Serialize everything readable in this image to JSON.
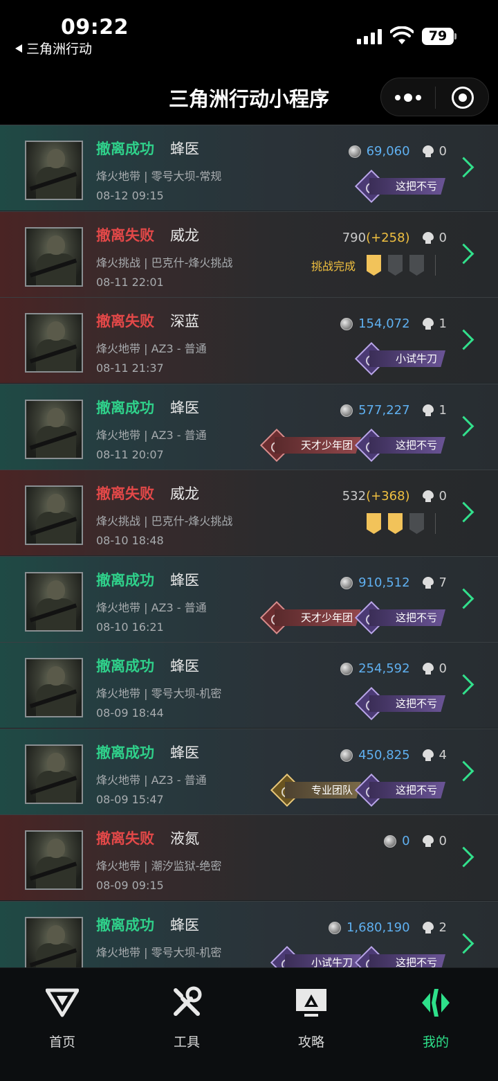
{
  "status_bar": {
    "time": "09:22",
    "back_app": "三角洲行动",
    "battery": "79"
  },
  "nav": {
    "title": "三角洲行动小程序"
  },
  "colors": {
    "success": "#2fd08a",
    "fail": "#e24848",
    "value_blue": "#5fb0f0",
    "bonus_yellow": "#f0c040",
    "accent_green": "#32e08c"
  },
  "records": [
    {
      "status": "撤离成功",
      "result": "success",
      "operator": "蜂医",
      "mode": "烽火地带 | 零号大坝-常规",
      "date": "08-12 09:15",
      "value": "69,060",
      "kills": "0",
      "badges": [
        {
          "label": "这把不亏",
          "style": "purple"
        }
      ]
    },
    {
      "status": "撤离失败",
      "result": "fail",
      "operator": "威龙",
      "mode": "烽火挑战 | 巴克什-烽火挑战",
      "date": "08-11 22:01",
      "value": "790",
      "bonus": "(+258)",
      "kills": "0",
      "challenge": {
        "label": "挑战完成",
        "filled": 1,
        "total": 3
      }
    },
    {
      "status": "撤离失败",
      "result": "fail",
      "operator": "深蓝",
      "mode": "烽火地带 | AZ3 - 普通",
      "date": "08-11 21:37",
      "value": "154,072",
      "kills": "1",
      "badges": [
        {
          "label": "小试牛刀",
          "style": "purple"
        }
      ]
    },
    {
      "status": "撤离成功",
      "result": "success",
      "operator": "蜂医",
      "mode": "烽火地带 | AZ3 - 普通",
      "date": "08-11 20:07",
      "value": "577,227",
      "kills": "1",
      "badges": [
        {
          "label": "天才少年团",
          "style": "red"
        },
        {
          "label": "这把不亏",
          "style": "purple"
        }
      ]
    },
    {
      "status": "撤离失败",
      "result": "fail",
      "operator": "威龙",
      "mode": "烽火挑战 | 巴克什-烽火挑战",
      "date": "08-10 18:48",
      "value": "532",
      "bonus": "(+368)",
      "kills": "0",
      "challenge": {
        "label": "",
        "filled": 2,
        "total": 3
      }
    },
    {
      "status": "撤离成功",
      "result": "success",
      "operator": "蜂医",
      "mode": "烽火地带 | AZ3 - 普通",
      "date": "08-10 16:21",
      "value": "910,512",
      "kills": "7",
      "badges": [
        {
          "label": "天才少年团",
          "style": "red"
        },
        {
          "label": "这把不亏",
          "style": "purple"
        }
      ]
    },
    {
      "status": "撤离成功",
      "result": "success",
      "operator": "蜂医",
      "mode": "烽火地带 | 零号大坝-机密",
      "date": "08-09 18:44",
      "value": "254,592",
      "kills": "0",
      "badges": [
        {
          "label": "这把不亏",
          "style": "purple"
        }
      ]
    },
    {
      "status": "撤离成功",
      "result": "success",
      "operator": "蜂医",
      "mode": "烽火地带 | AZ3 - 普通",
      "date": "08-09 15:47",
      "value": "450,825",
      "kills": "4",
      "badges": [
        {
          "label": "专业团队",
          "style": "gold"
        },
        {
          "label": "这把不亏",
          "style": "purple"
        }
      ]
    },
    {
      "status": "撤离失败",
      "result": "fail",
      "operator": "液氮",
      "mode": "烽火地带 | 潮汐监狱-绝密",
      "date": "08-09 09:15",
      "value": "0",
      "kills": "0"
    },
    {
      "status": "撤离成功",
      "result": "success",
      "operator": "蜂医",
      "mode": "烽火地带 | 零号大坝-机密",
      "date": "",
      "value": "1,680,190",
      "kills": "2",
      "badges": [
        {
          "label": "小试牛刀",
          "style": "purple"
        },
        {
          "label": "这把不亏",
          "style": "purple"
        }
      ]
    }
  ],
  "tabs": [
    {
      "label": "首页",
      "icon": "home-logo-icon"
    },
    {
      "label": "工具",
      "icon": "tools-icon"
    },
    {
      "label": "攻略",
      "icon": "guide-icon"
    },
    {
      "label": "我的",
      "icon": "profile-logo-icon",
      "active": true
    }
  ]
}
